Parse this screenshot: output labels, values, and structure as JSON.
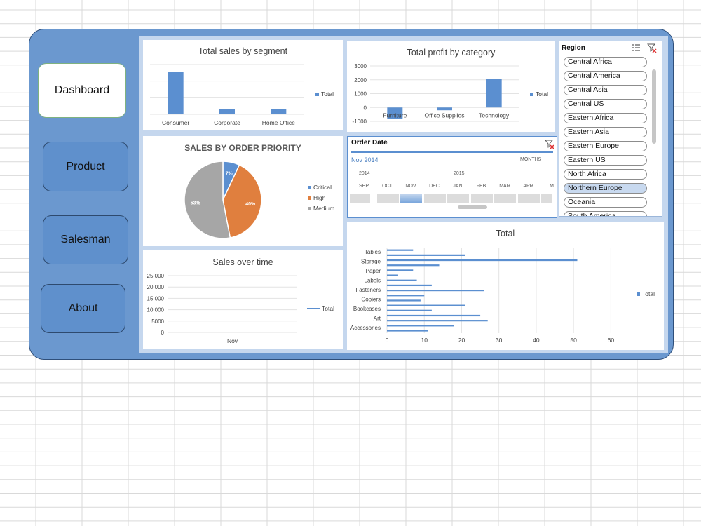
{
  "nav": [
    {
      "label": "Dashboard",
      "active": true
    },
    {
      "label": "Product",
      "active": false
    },
    {
      "label": "Salesman",
      "active": false
    },
    {
      "label": "About",
      "active": false
    }
  ],
  "colors": {
    "frame": "#6b98cf",
    "accent": "#5b8fd0",
    "orange": "#e07f3e",
    "gray": "#a6a6a6",
    "selected": "#c8d9ef"
  },
  "segment_chart": {
    "title": "Total sales by segment",
    "legend": "Total"
  },
  "profit_chart": {
    "title": "Total profit by category",
    "legend": "Total"
  },
  "priority_chart": {
    "title": "SALES BY ORDER PRIORITY",
    "legend": [
      "Critical",
      "High",
      "Medium"
    ],
    "labels": [
      "7%",
      "40%",
      "53%"
    ]
  },
  "time_chart": {
    "title": "Sales over time",
    "legend": "Total"
  },
  "subcat_chart": {
    "title": "Total",
    "legend": "Total"
  },
  "timeline": {
    "title": "Order Date",
    "selection": "Nov 2014",
    "level": "MONTHS",
    "years": [
      "2014",
      "2015"
    ],
    "months": [
      "SEP",
      "OCT",
      "NOV",
      "DEC",
      "JAN",
      "FEB",
      "MAR",
      "APR",
      "M"
    ],
    "selected_month": "NOV"
  },
  "region_slicer": {
    "title": "Region",
    "items": [
      {
        "label": "Central Africa",
        "selected": false
      },
      {
        "label": "Central America",
        "selected": false
      },
      {
        "label": "Central Asia",
        "selected": false
      },
      {
        "label": "Central US",
        "selected": false
      },
      {
        "label": "Eastern Africa",
        "selected": false
      },
      {
        "label": "Eastern Asia",
        "selected": false
      },
      {
        "label": "Eastern Europe",
        "selected": false
      },
      {
        "label": "Eastern US",
        "selected": false
      },
      {
        "label": "North Africa",
        "selected": false
      },
      {
        "label": "Northern Europe",
        "selected": true
      },
      {
        "label": "Oceania",
        "selected": false
      },
      {
        "label": "South America",
        "selected": false
      }
    ]
  },
  "icons": {
    "multiselect": "multi-select-icon",
    "clear_filter": "clear-filter-icon"
  },
  "chart_data": [
    {
      "type": "bar",
      "title": "Total sales by segment",
      "categories": [
        "Consumer",
        "Corporate",
        "Home Office"
      ],
      "series": [
        {
          "name": "Total",
          "values": [
            3300,
            420,
            420
          ]
        }
      ],
      "ylim": [
        0,
        3900
      ],
      "grid": true,
      "legend": "right"
    },
    {
      "type": "bar",
      "title": "Total profit by category",
      "categories": [
        "Furniture",
        "Office Supplies",
        "Technology"
      ],
      "series": [
        {
          "name": "Total",
          "values": [
            -800,
            -200,
            2050
          ]
        }
      ],
      "ylim": [
        -1000,
        3000
      ],
      "yticks": [
        "3000",
        "2000",
        "1000",
        "0",
        "-1000"
      ],
      "grid": true,
      "legend": "right"
    },
    {
      "type": "pie",
      "title": "SALES BY ORDER PRIORITY",
      "categories": [
        "Critical",
        "High",
        "Medium"
      ],
      "values": [
        7,
        40,
        53
      ],
      "legend": "right"
    },
    {
      "type": "line",
      "title": "Sales over time",
      "categories": [
        "Nov"
      ],
      "series": [
        {
          "name": "Total",
          "values": [
            0
          ]
        }
      ],
      "ylim": [
        0,
        25000
      ],
      "yticks": [
        "25 000",
        "20 000",
        "15 000",
        "10 000",
        "5000",
        "0"
      ],
      "grid": true,
      "legend": "right"
    },
    {
      "type": "bar",
      "orientation": "horizontal",
      "title": "Total",
      "categories": [
        "Tables",
        "Storage",
        "Paper",
        "Labels",
        "Fasteners",
        "Copiers",
        "Bookcases",
        "Art",
        "Accessories"
      ],
      "category_labels_shown": [
        "Tables",
        "Storage",
        "Paper",
        "Labels",
        "Fasteners",
        "Copiers",
        "Bookcases",
        "Art",
        "Accessories"
      ],
      "bars": [
        7,
        21,
        51,
        14,
        7,
        3,
        8,
        12,
        26,
        10,
        9,
        21,
        12,
        25,
        27,
        18,
        11
      ],
      "xlim": [
        0,
        65
      ],
      "xticks": [
        "0",
        "10",
        "20",
        "30",
        "40",
        "50",
        "60"
      ],
      "grid": true,
      "legend": "right"
    }
  ]
}
